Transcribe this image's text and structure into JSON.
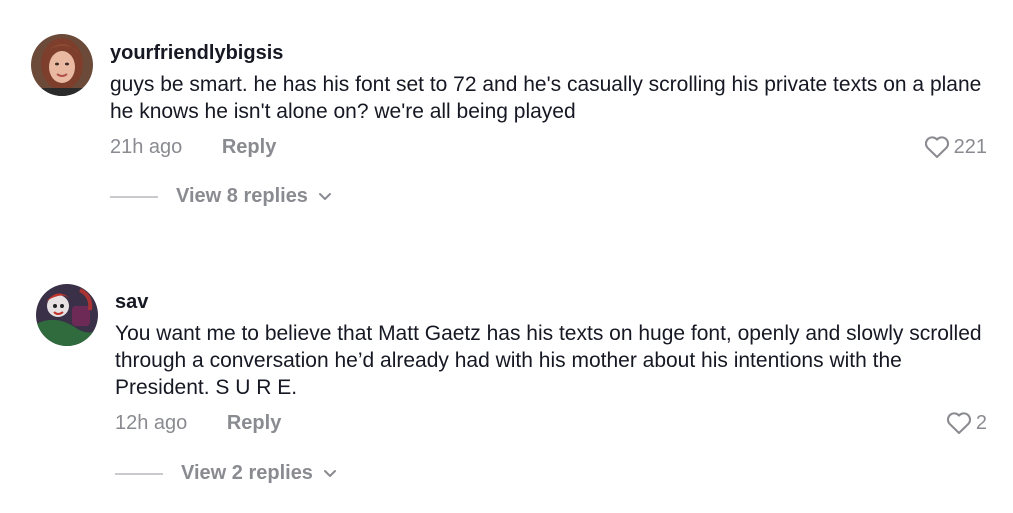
{
  "comments": [
    {
      "username": "yourfriendlybigsis",
      "text": "guys be smart. he has his font set to 72 and he's casually scrolling his private texts on a plane he knows he isn't alone on? we're all being played",
      "time": "21h ago",
      "reply_label": "Reply",
      "likes": "221",
      "view_replies": "View 8 replies"
    },
    {
      "username": "sav",
      "text": "You want me to believe that Matt Gaetz has his texts on huge font, openly and slowly scrolled through a conversation he’d already had with his mother about his intentions with the President. S U R E.",
      "time": "12h ago",
      "reply_label": "Reply",
      "likes": "2",
      "view_replies": "View 2 replies"
    }
  ]
}
